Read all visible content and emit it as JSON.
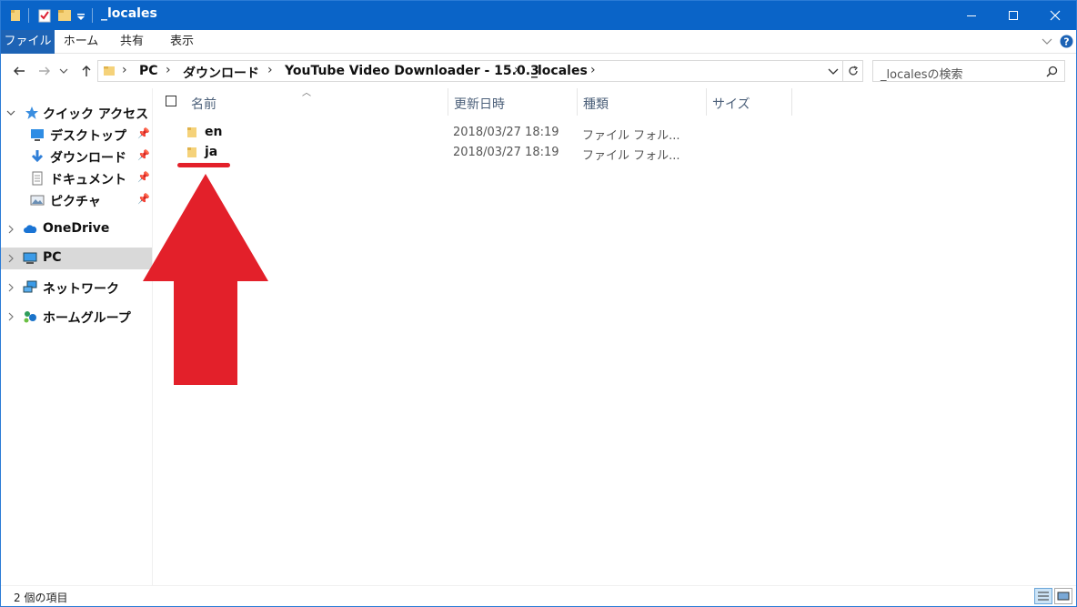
{
  "window": {
    "title": "_locales",
    "accent": "#0a64c8"
  },
  "ribbon": {
    "tabs": [
      {
        "label": "ファイル"
      },
      {
        "label": "ホーム"
      },
      {
        "label": "共有"
      },
      {
        "label": "表示"
      }
    ]
  },
  "address": {
    "crumbs": [
      "PC",
      "ダウンロード",
      "YouTube Video Downloader - 15.0.3",
      "_locales"
    ]
  },
  "search": {
    "placeholder": "_localesの検索"
  },
  "nav_pane": {
    "items": [
      {
        "label": "クイック アクセス",
        "icon": "star-icon"
      },
      {
        "label": "デスクトップ",
        "icon": "desktop-icon"
      },
      {
        "label": "ダウンロード",
        "icon": "download-icon"
      },
      {
        "label": "ドキュメント",
        "icon": "document-icon"
      },
      {
        "label": "ピクチャ",
        "icon": "picture-icon"
      },
      {
        "label": "OneDrive",
        "icon": "cloud-icon"
      },
      {
        "label": "PC",
        "icon": "computer-icon"
      },
      {
        "label": "ネットワーク",
        "icon": "network-icon"
      },
      {
        "label": "ホームグループ",
        "icon": "homegroup-icon"
      }
    ]
  },
  "columns": {
    "name": "名前",
    "date": "更新日時",
    "type": "種類",
    "size": "サイズ"
  },
  "files": [
    {
      "name": "en",
      "date": "2018/03/27 18:19",
      "type": "ファイル フォル..."
    },
    {
      "name": "ja",
      "date": "2018/03/27 18:19",
      "type": "ファイル フォル..."
    }
  ],
  "status": {
    "count_text": "2 個の項目"
  },
  "annotation": {
    "color": "#e3202a"
  }
}
